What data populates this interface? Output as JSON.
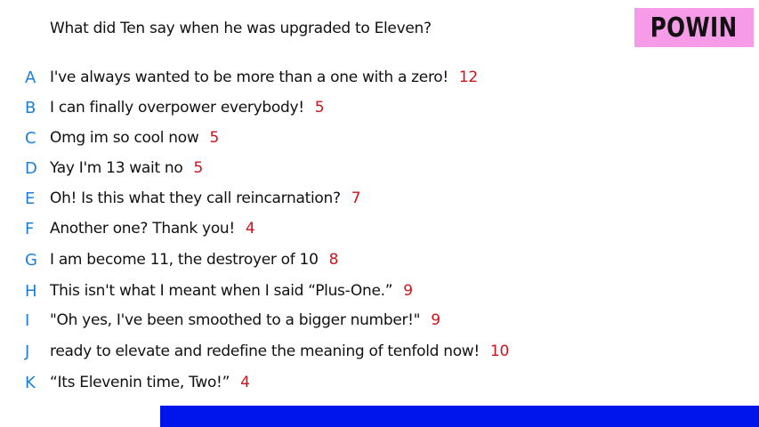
{
  "question": "What did Ten say when he was upgraded to Eleven?",
  "logo": "POWIN",
  "options": [
    {
      "letter": "A",
      "text": "I've always wanted to be more than a one with a zero!",
      "score": "12"
    },
    {
      "letter": "B",
      "text": "I can finally overpower everybody!",
      "score": "5"
    },
    {
      "letter": "C",
      "text": "Omg im so cool now",
      "score": "5"
    },
    {
      "letter": "D",
      "text": "Yay I'm 13 wait no",
      "score": "5"
    },
    {
      "letter": "E",
      "text": "Oh! Is this what they call reincarnation?",
      "score": "7"
    },
    {
      "letter": "F",
      "text": "Another one? Thank you!",
      "score": "4"
    },
    {
      "letter": "G",
      "text": "I am become 11, the destroyer of 10",
      "score": "8"
    },
    {
      "letter": "H",
      "text": "This isn't what I meant when I said “Plus-One.”",
      "score": "9"
    },
    {
      "letter": "I",
      "text": "\"Oh yes, I've been smoothed to a bigger number!\"",
      "score": "9"
    },
    {
      "letter": "J",
      "text": "ready to elevate and redefine the meaning of tenfold now!",
      "score": "10"
    },
    {
      "letter": "K",
      "text": "“Its Elevenin time, Two!”",
      "score": "4"
    }
  ],
  "colors": {
    "letter": "#1b7fd6",
    "score": "#d0121b",
    "logo_bg": "#f59be8",
    "bottom_bar": "#0015ec"
  }
}
